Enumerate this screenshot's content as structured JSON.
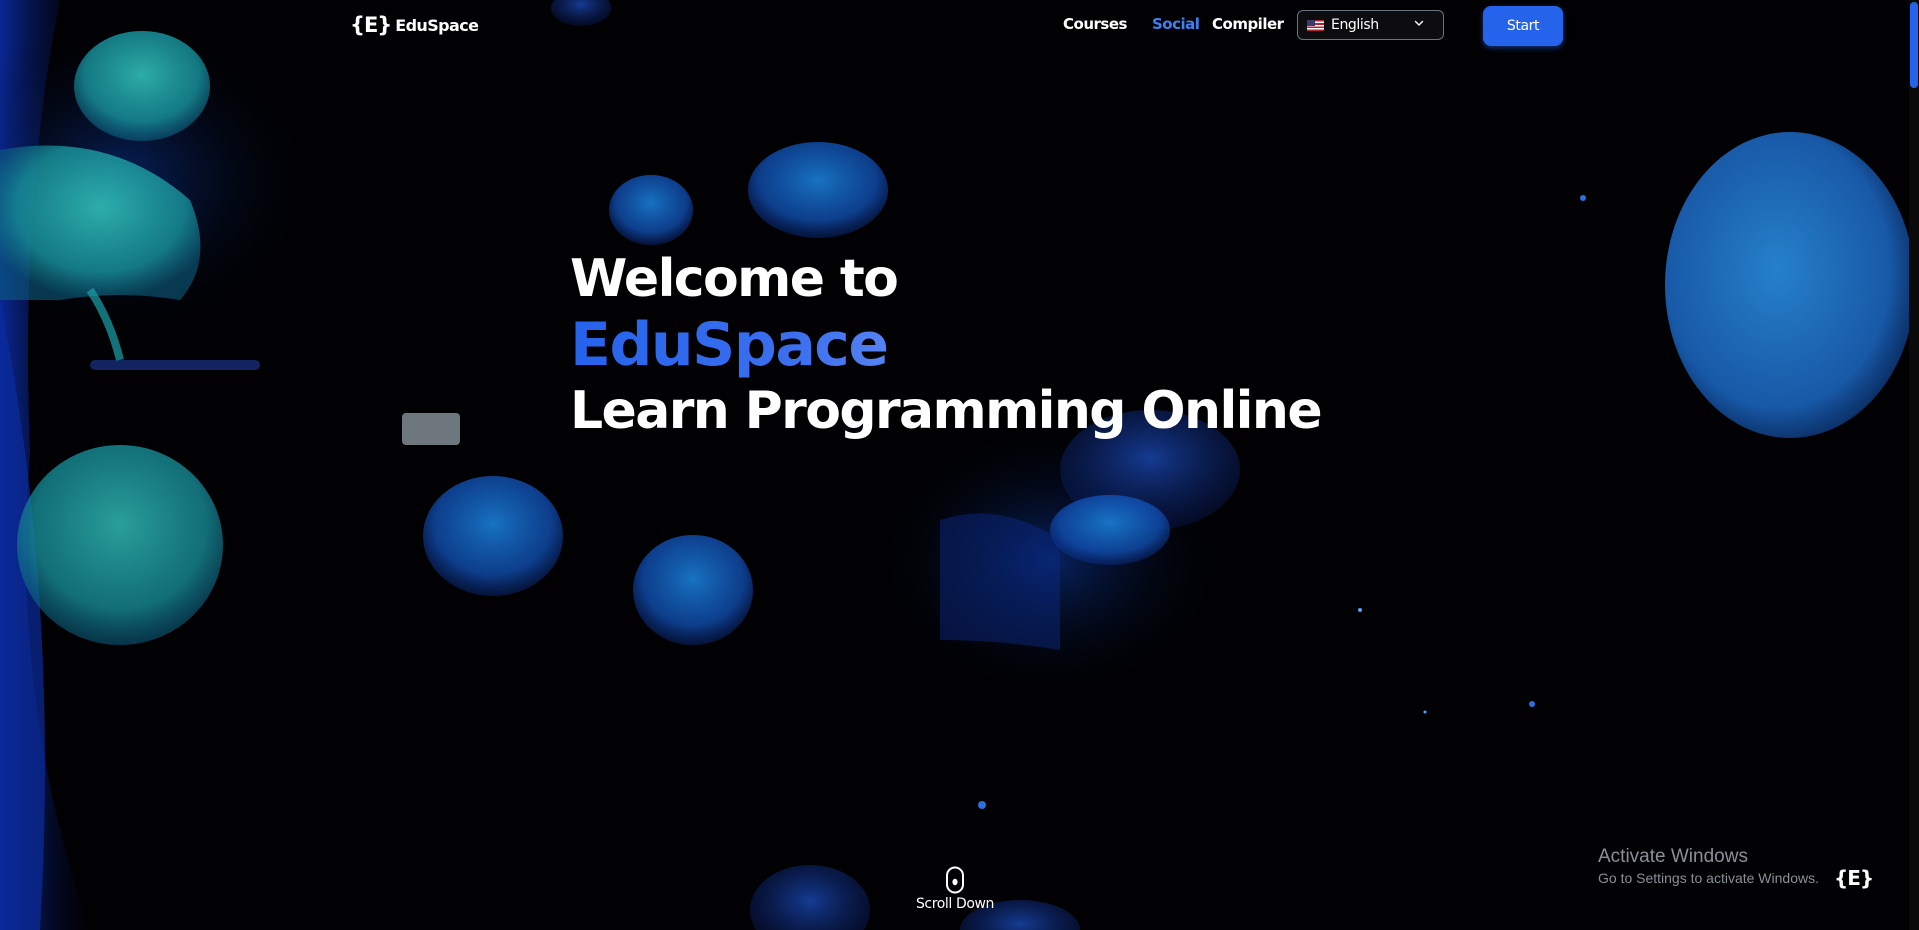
{
  "header": {
    "logo_mark": "{E}",
    "logo_text": "EduSpace",
    "nav": {
      "courses": "Courses",
      "social": "Social",
      "compiler": "Compiler"
    },
    "language": {
      "selected": "English",
      "flag_icon": "us-flag-icon"
    },
    "start_label": "Start"
  },
  "hero": {
    "line1": "Welcome to",
    "brand": "EduSpace",
    "line3": "Learn Programming Online"
  },
  "scroll": {
    "label": "Scroll Down",
    "icon": "mouse-icon"
  },
  "watermark": {
    "title": "Activate Windows",
    "subtitle": "Go to Settings to activate Windows."
  },
  "corner_logo": "{E}",
  "colors": {
    "accent": "#2563eb",
    "active_nav": "#3b82f6",
    "background": "#010104",
    "jellyfish": "#1aa3a8"
  }
}
